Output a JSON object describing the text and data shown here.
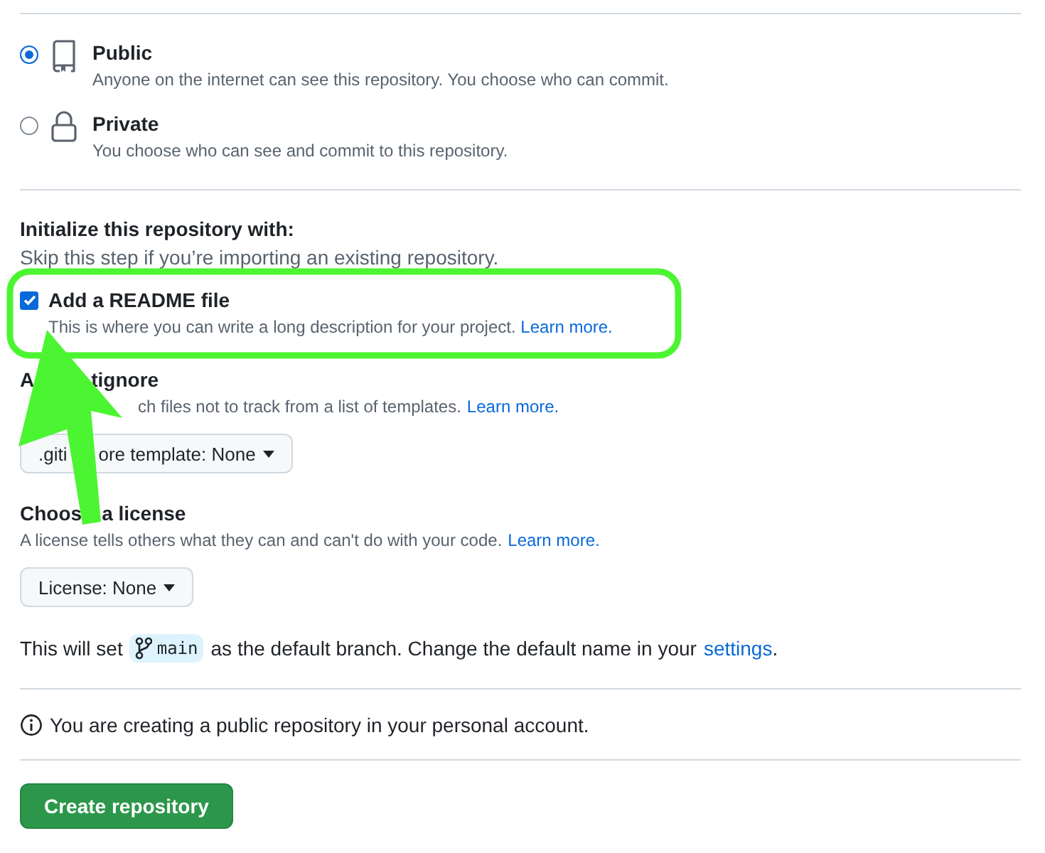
{
  "visibility": [
    {
      "kind": "repo",
      "label": "Public",
      "description": "Anyone on the internet can see this repository. You choose who can commit.",
      "selected": true
    },
    {
      "kind": "lock",
      "label": "Private",
      "description": "You choose who can see and commit to this repository.",
      "selected": false
    }
  ],
  "initialize": {
    "title": "Initialize this repository with:",
    "hint": "Skip this step if you’re importing an existing repository.",
    "readme": {
      "label": "Add a README file",
      "description": "This is where you can write a long description for your project.",
      "link": "Learn more.",
      "checked": true
    },
    "gitignore": {
      "title": [
        "A",
        "tignore"
      ],
      "description": [
        "ch files not to track from a list of templates."
      ],
      "link": "Learn more.",
      "dropdown": [
        ".giti",
        "ore template: None"
      ]
    },
    "license": {
      "title": [
        "Choos",
        "a license"
      ],
      "description": [
        "A license tells others what they can and can't do with your code."
      ],
      "link": "Learn more.",
      "dropdown": [
        "License: None"
      ]
    }
  },
  "branch_note": {
    "before": "This will set",
    "branch": "main",
    "after": "as the default branch. Change the default name in your",
    "link": "settings",
    "end": "."
  },
  "info": "You are creating a public repository in your personal account.",
  "create_button": "Create repository",
  "annotation": {
    "highlight": true,
    "arrow": true
  }
}
